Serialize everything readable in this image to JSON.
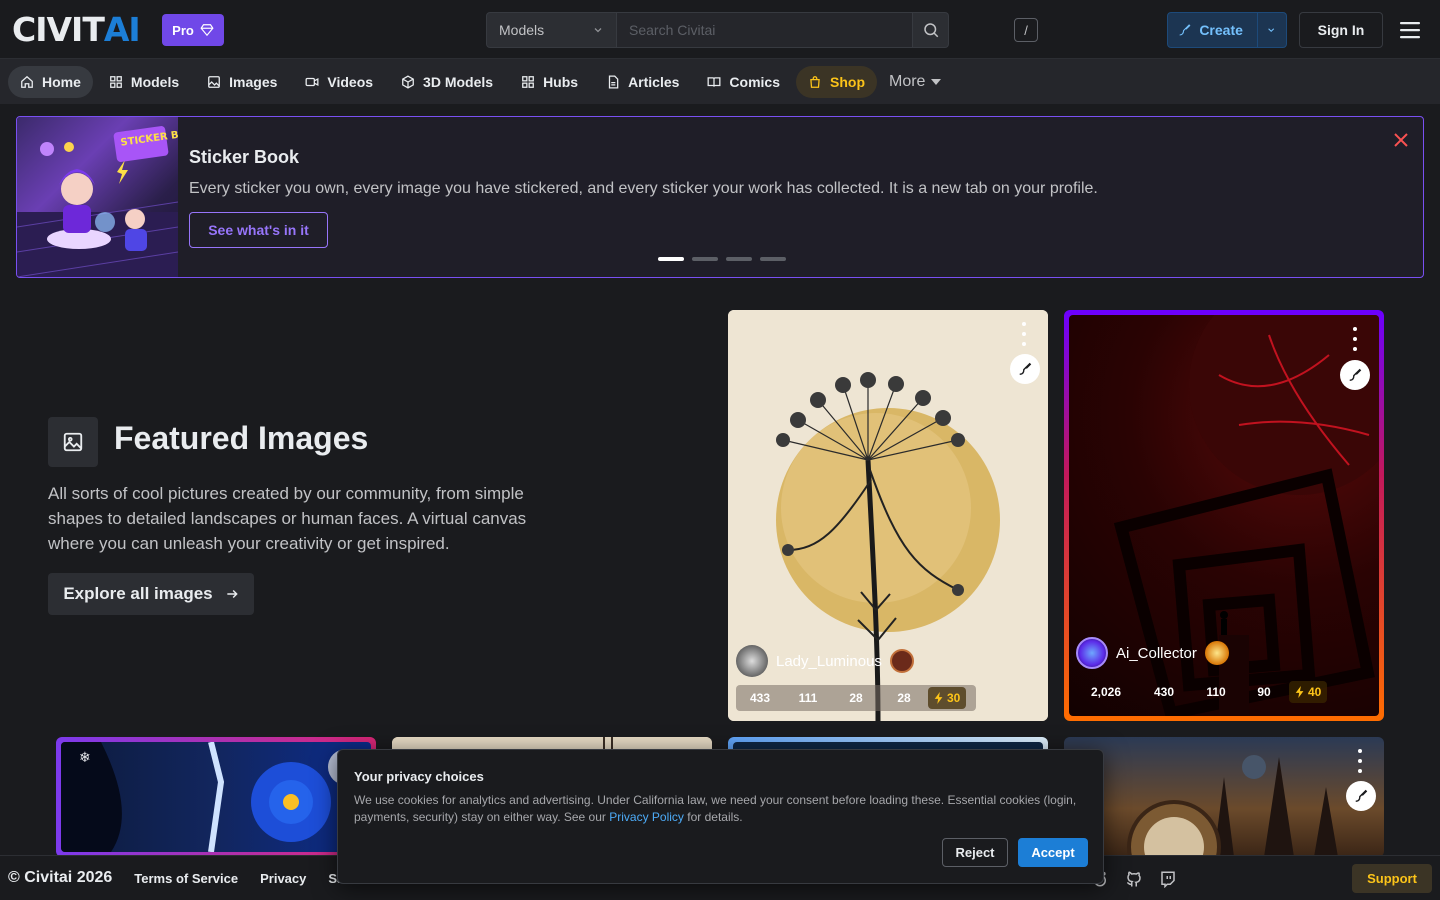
{
  "header": {
    "logo_civ": "CIVIT",
    "logo_ai": "AI",
    "pro_label": "Pro",
    "search_type": "Models",
    "search_placeholder": "Search Civitai",
    "shortcut_key": "/",
    "create_label": "Create",
    "signin_label": "Sign In"
  },
  "nav": {
    "items": [
      {
        "label": "Home",
        "icon": "home-icon"
      },
      {
        "label": "Models",
        "icon": "grid-icon"
      },
      {
        "label": "Images",
        "icon": "image-icon"
      },
      {
        "label": "Videos",
        "icon": "video-icon"
      },
      {
        "label": "3D Models",
        "icon": "cube-icon"
      },
      {
        "label": "Hubs",
        "icon": "grid-icon"
      },
      {
        "label": "Articles",
        "icon": "file-icon"
      },
      {
        "label": "Comics",
        "icon": "book-icon"
      },
      {
        "label": "Shop",
        "icon": "shopping-bag-icon"
      }
    ],
    "more_label": "More"
  },
  "banner": {
    "image_text": "STICKER BOOK",
    "title": "Sticker Book",
    "text": "Every sticker you own, every image you have stickered, and every sticker your work has collected. It is a new tab on your profile.",
    "cta": "See what's in it",
    "slide_count": 4,
    "active_slide": 1
  },
  "featured": {
    "title": "Featured Images",
    "description": "All sorts of cool pictures created by our community, from simple shapes to detailed landscapes or human faces. A virtual canvas where you can unleash your creativity or get inspired.",
    "cta": "Explore all images"
  },
  "cards": [
    {
      "username": "Lady_Luminous",
      "stats": [
        "433",
        "111",
        "28",
        "28"
      ],
      "buzz": "30"
    },
    {
      "username": "Ai_Collector",
      "stats": [
        "2,026",
        "430",
        "110",
        "90"
      ],
      "buzz": "40"
    }
  ],
  "footer": {
    "copyright": "© Civitai 2026",
    "links": [
      "Terms of Service",
      "Privacy",
      "Sa"
    ],
    "support": "Support"
  },
  "privacy": {
    "title": "Your privacy choices",
    "text_before": "We use cookies for analytics and advertising. Under California law, we need your consent before loading these. Essential cookies (login, payments, security) stay on either way. See our ",
    "link": "Privacy Policy",
    "text_after": " for details.",
    "reject": "Reject",
    "accept": "Accept"
  },
  "colors": {
    "background": "#1a1b1e",
    "accent_blue": "#1c7ed6",
    "accent_violet": "#7950f2",
    "shop_gold": "#fcc419"
  }
}
